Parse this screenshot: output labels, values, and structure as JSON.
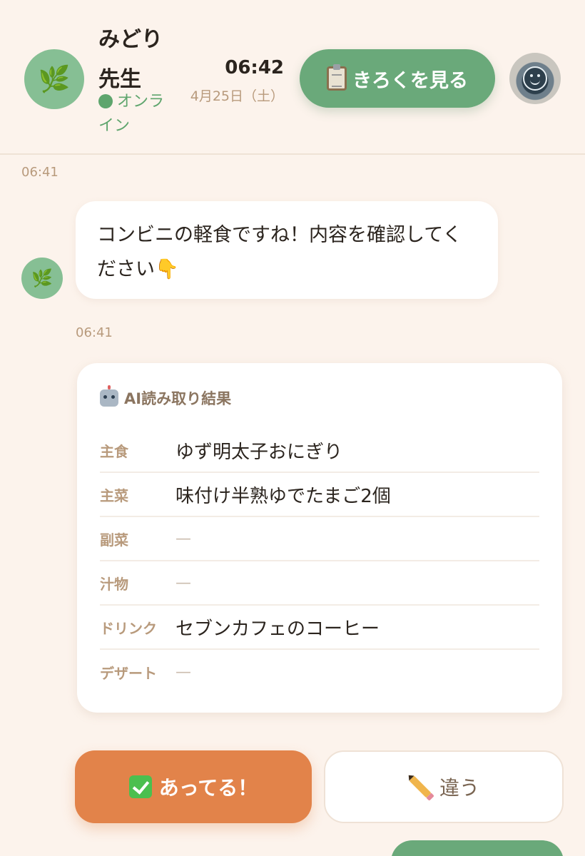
{
  "header": {
    "bot_avatar_icon": "herb-icon",
    "bot_name": "みどり先生",
    "status": "オンライン",
    "status_color": "#5ea56d",
    "time": "06:42",
    "date": "4月25日（土）",
    "records_button": "きろくを見る",
    "records_icon": "clipboard-icon",
    "user_avatar_icon": "smiley-cup-avatar"
  },
  "chat": {
    "timestamp_1": "06:41",
    "message_1": "コンビニの軽食ですね！内容を確認してください👇",
    "timestamp_2": "06:41"
  },
  "result_card": {
    "title_icon": "robot-icon",
    "title": "AI読み取り結果",
    "rows": [
      {
        "label": "主食",
        "value": "ゆず明太子おにぎり"
      },
      {
        "label": "主菜",
        "value": "味付け半熟ゆでたまご2個"
      },
      {
        "label": "副菜",
        "value": "—"
      },
      {
        "label": "汁物",
        "value": "—"
      },
      {
        "label": "ドリンク",
        "value": "セブンカフェのコーヒー"
      },
      {
        "label": "デザート",
        "value": "—"
      }
    ]
  },
  "actions": {
    "confirm_label": "あってる！",
    "confirm_icon": "check-icon",
    "confirm_color": "#e2834a",
    "reject_label": "違う",
    "reject_icon": "pencil-icon"
  },
  "colors": {
    "background": "#fcf3ec",
    "accent_green": "#6aa97a",
    "accent_orange": "#e2834a"
  }
}
